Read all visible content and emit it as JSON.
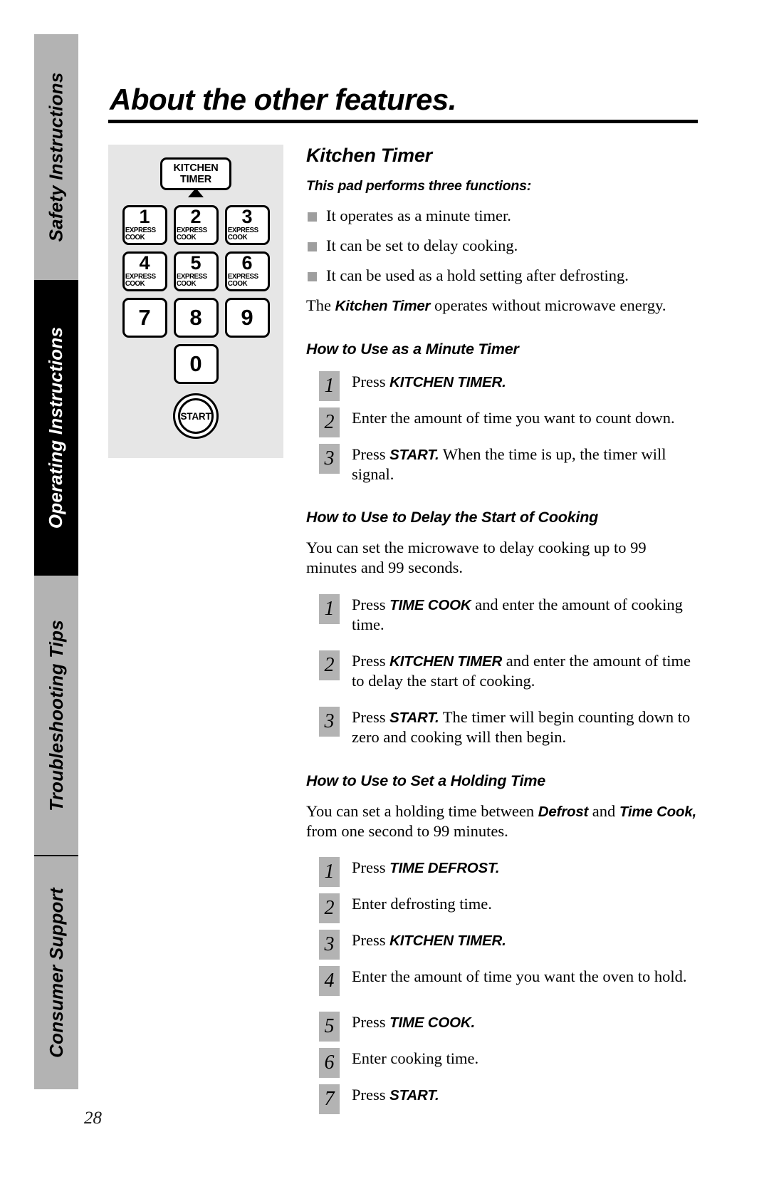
{
  "page": {
    "title": "About the other features.",
    "number": "28"
  },
  "sidebar": {
    "tabs": [
      {
        "label": "Safety Instructions",
        "active": false
      },
      {
        "label": "Operating Instructions",
        "active": true
      },
      {
        "label": "Troubleshooting Tips",
        "active": false
      },
      {
        "label": "Consumer Support",
        "active": false
      }
    ]
  },
  "keypad": {
    "kitchen_timer": {
      "line1": "KITCHEN",
      "line2": "TIMER"
    },
    "keys": [
      {
        "digit": "1",
        "sub": "EXPRESS COOK"
      },
      {
        "digit": "2",
        "sub": "EXPRESS COOK"
      },
      {
        "digit": "3",
        "sub": "EXPRESS COOK"
      },
      {
        "digit": "4",
        "sub": "EXPRESS COOK"
      },
      {
        "digit": "5",
        "sub": "EXPRESS COOK"
      },
      {
        "digit": "6",
        "sub": "EXPRESS COOK"
      },
      {
        "digit": "7",
        "sub": ""
      },
      {
        "digit": "8",
        "sub": ""
      },
      {
        "digit": "9",
        "sub": ""
      }
    ],
    "zero": {
      "digit": "0",
      "sub": ""
    },
    "start": {
      "label": "START"
    }
  },
  "section": {
    "title": "Kitchen Timer",
    "lead": "This pad performs three functions:",
    "bullets": [
      "It operates as a minute timer.",
      "It can be set to delay cooking.",
      "It can be used as a hold setting after defrosting."
    ],
    "note_prefix": "The ",
    "note_bold": "Kitchen Timer",
    "note_suffix": " operates without microwave energy."
  },
  "minute_timer": {
    "heading": "How to Use as a Minute Timer",
    "steps": [
      {
        "n": "1",
        "prefix": "Press ",
        "bold": "KITCHEN TIMER.",
        "suffix": ""
      },
      {
        "n": "2",
        "prefix": "Enter the amount of time you want to count down.",
        "bold": "",
        "suffix": ""
      },
      {
        "n": "3",
        "prefix": "Press ",
        "bold": "START.",
        "suffix": " When the time is up, the timer will signal."
      }
    ]
  },
  "delay_cooking": {
    "heading": "How to Use to Delay the Start of Cooking",
    "intro": "You can set the microwave to delay cooking up to 99 minutes and 99 seconds.",
    "steps": [
      {
        "n": "1",
        "prefix": "Press ",
        "bold": "TIME COOK",
        "suffix": "  and enter the amount of cooking time."
      },
      {
        "n": "2",
        "prefix": "Press ",
        "bold": "KITCHEN TIMER",
        "suffix": " and enter the amount of time to delay the start of cooking."
      },
      {
        "n": "3",
        "prefix": "Press ",
        "bold": "START.",
        "suffix": " The timer will begin counting down to zero and cooking will then begin."
      }
    ]
  },
  "holding_time": {
    "heading": "How to Use to Set a Holding Time",
    "intro_1": "You can set a holding time between ",
    "intro_bold_1": "Defrost",
    "intro_2": "  and ",
    "intro_bold_2": "Time Cook,",
    "intro_3": " from one second to 99 minutes.",
    "steps": [
      {
        "n": "1",
        "prefix": "Press ",
        "bold": "TIME DEFROST.",
        "suffix": ""
      },
      {
        "n": "2",
        "prefix": "Enter defrosting time.",
        "bold": "",
        "suffix": ""
      },
      {
        "n": "3",
        "prefix": "Press ",
        "bold": "KITCHEN TIMER.",
        "suffix": ""
      },
      {
        "n": "4",
        "prefix": "Enter the amount of time you want the oven to hold.",
        "bold": "",
        "suffix": ""
      },
      {
        "n": "5",
        "prefix": "Press ",
        "bold": "TIME COOK.",
        "suffix": ""
      },
      {
        "n": "6",
        "prefix": "Enter cooking time.",
        "bold": "",
        "suffix": ""
      },
      {
        "n": "7",
        "prefix": "Press ",
        "bold": "START.",
        "suffix": ""
      }
    ]
  }
}
